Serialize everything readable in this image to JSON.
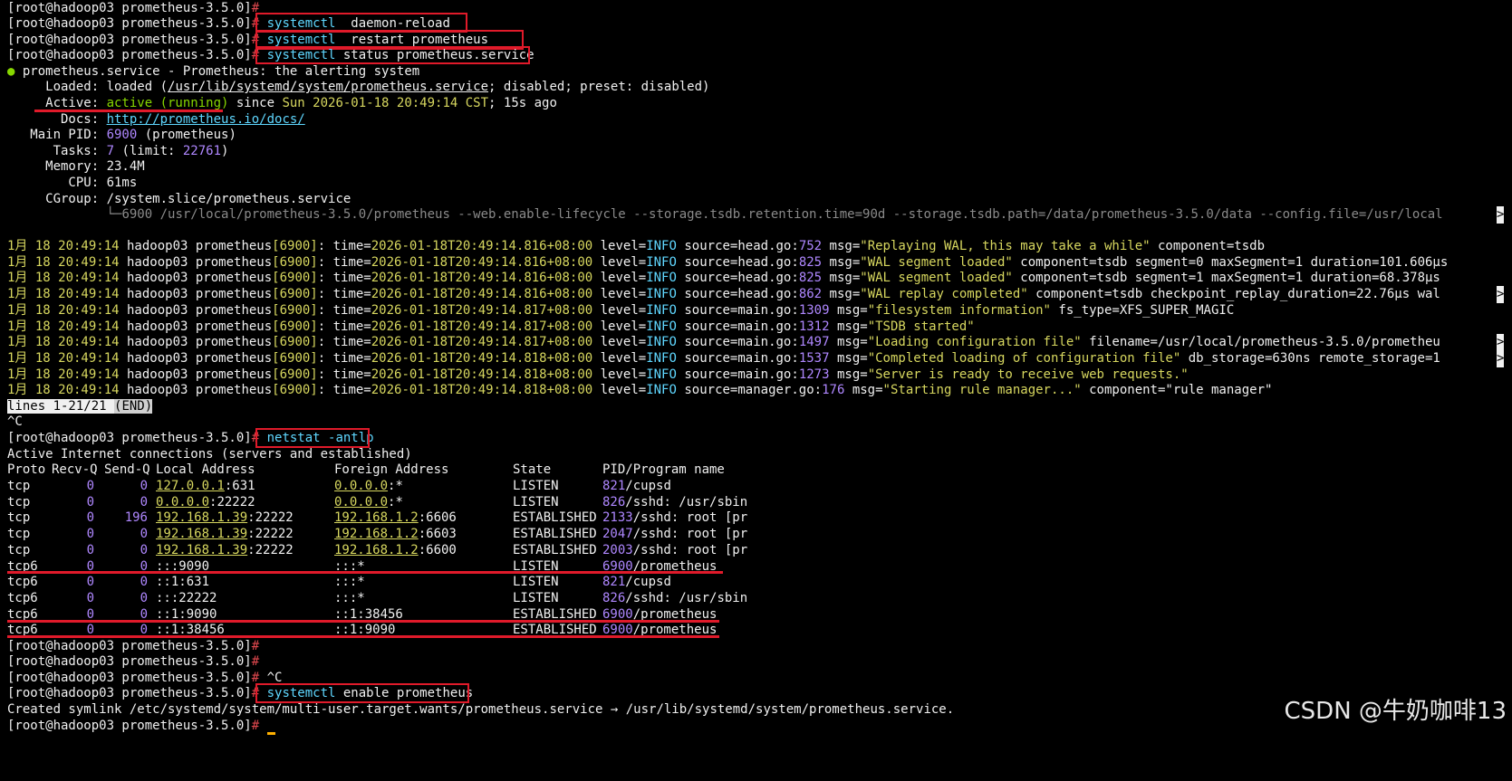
{
  "prompt": "[root@hadoop03 prometheus-3.5.0]",
  "hash": "#",
  "cmds": {
    "c1a": "systemctl",
    "c1b": "  daemon-reload",
    "c2a": "systemctl",
    "c2b": "  restart prometheus",
    "c3a": "systemctl",
    "c3b": " status prometheus.service",
    "c4": "netstat -antlp",
    "c5a": "systemctl",
    "c5b": " enable prometheus"
  },
  "status": {
    "bullet": "●",
    "unit": "prometheus.service",
    "desc": " - Prometheus: the alerting system",
    "loaded_label": "     Loaded: ",
    "loaded_text": "loaded (",
    "loaded_path": "/usr/lib/systemd/system/prometheus.service",
    "loaded_rest": "; disabled; preset: disabled)",
    "active_label": "     Active: ",
    "active_state": "active (running)",
    "active_since": " since ",
    "active_time": "Sun 2026-01-18 20:49:14 CST",
    "active_ago": "; 15s ago",
    "docs_label": "       Docs: ",
    "docs_url": "http://prometheus.io/docs/",
    "pid_label": "   Main PID: ",
    "pid_num": "6900",
    "pid_name": " (prometheus)",
    "tasks_label": "      Tasks: ",
    "tasks_num": "7",
    "tasks_limit_label": " (limit: ",
    "tasks_limit": "22761",
    "tasks_close": ")",
    "memory_label": "     Memory: ",
    "memory_val": "23.4M",
    "cpu_label": "        CPU: ",
    "cpu_val": "61ms",
    "cgroup_label": "     CGroup: ",
    "cgroup_val": "/system.slice/prometheus.service",
    "cgroup_tree": "             └─",
    "cgroup_cmd": "6900 /usr/local/prometheus-3.5.0/prometheus --web.enable-lifecycle --storage.tsdb.retention.time=90d --storage.tsdb.path=/data/prometheus-3.5.0/data --config.file=/usr/local",
    "more_marker": ">"
  },
  "logs": [
    {
      "date": "1月 18 20:49:14",
      "host": " hadoop03 prometheus",
      "pid": "[6900]",
      "time": "2026-01-18T20:49:14.816+08:00",
      "src": "head.go",
      "line": "752",
      "msg": "\"Replaying WAL, this may take a while\"",
      "rest": " component=tsdb",
      "more": false
    },
    {
      "date": "1月 18 20:49:14",
      "host": " hadoop03 prometheus",
      "pid": "[6900]",
      "time": "2026-01-18T20:49:14.816+08:00",
      "src": "head.go",
      "line": "825",
      "msg": "\"WAL segment loaded\"",
      "rest": " component=tsdb segment=0 maxSegment=1 duration=101.606μs",
      "more": false
    },
    {
      "date": "1月 18 20:49:14",
      "host": " hadoop03 prometheus",
      "pid": "[6900]",
      "time": "2026-01-18T20:49:14.816+08:00",
      "src": "head.go",
      "line": "825",
      "msg": "\"WAL segment loaded\"",
      "rest": " component=tsdb segment=1 maxSegment=1 duration=68.378μs",
      "more": false
    },
    {
      "date": "1月 18 20:49:14",
      "host": " hadoop03 prometheus",
      "pid": "[6900]",
      "time": "2026-01-18T20:49:14.816+08:00",
      "src": "head.go",
      "line": "862",
      "msg": "\"WAL replay completed\"",
      "rest": " component=tsdb checkpoint_replay_duration=22.76μs wal",
      "more": true
    },
    {
      "date": "1月 18 20:49:14",
      "host": " hadoop03 prometheus",
      "pid": "[6900]",
      "time": "2026-01-18T20:49:14.817+08:00",
      "src": "main.go",
      "line": "1309",
      "msg": "\"filesystem information\"",
      "rest": " fs_type=XFS_SUPER_MAGIC",
      "more": false
    },
    {
      "date": "1月 18 20:49:14",
      "host": " hadoop03 prometheus",
      "pid": "[6900]",
      "time": "2026-01-18T20:49:14.817+08:00",
      "src": "main.go",
      "line": "1312",
      "msg": "\"TSDB started\"",
      "rest": "",
      "more": false
    },
    {
      "date": "1月 18 20:49:14",
      "host": " hadoop03 prometheus",
      "pid": "[6900]",
      "time": "2026-01-18T20:49:14.817+08:00",
      "src": "main.go",
      "line": "1497",
      "msg": "\"Loading configuration file\"",
      "rest": " filename=/usr/local/prometheus-3.5.0/prometheu",
      "more": true
    },
    {
      "date": "1月 18 20:49:14",
      "host": " hadoop03 prometheus",
      "pid": "[6900]",
      "time": "2026-01-18T20:49:14.818+08:00",
      "src": "main.go",
      "line": "1537",
      "msg": "\"Completed loading of configuration file\"",
      "rest": " db_storage=630ns remote_storage=1",
      "more": true
    },
    {
      "date": "1月 18 20:49:14",
      "host": " hadoop03 prometheus",
      "pid": "[6900]",
      "time": "2026-01-18T20:49:14.818+08:00",
      "src": "main.go",
      "line": "1273",
      "msg": "\"Server is ready to receive web requests.\"",
      "rest": "",
      "more": false
    },
    {
      "date": "1月 18 20:49:14",
      "host": " hadoop03 prometheus",
      "pid": "[6900]",
      "time": "2026-01-18T20:49:14.818+08:00",
      "src": "manager.go",
      "line": "176",
      "msg": "\"Starting rule manager...\"",
      "rest": " component=\"rule manager\"",
      "more": false
    }
  ],
  "log_labels": {
    "time": ": time=",
    "level": " level=",
    "level_val": "INFO",
    "source": " source=",
    "colon": ":",
    "msg": " msg="
  },
  "pager": {
    "lines": "lines 1-21/21 ",
    "end": "(END)"
  },
  "ctrl_c": "^C",
  "netstat": {
    "header1": "Active Internet connections (servers and established)",
    "cols": [
      "Proto",
      "Recv-Q",
      "Send-Q",
      "Local Address",
      "Foreign Address",
      "State",
      "PID/Program name"
    ],
    "rows": [
      {
        "proto": "tcp",
        "recv": "0",
        "send": "0",
        "lip": "127.0.0.1",
        "lport": ":631",
        "fip": "0.0.0.0",
        "fport": ":*",
        "state": "LISTEN",
        "pid": "821",
        "prog": "/cupsd"
      },
      {
        "proto": "tcp",
        "recv": "0",
        "send": "0",
        "lip": "0.0.0.0",
        "lport": ":22222",
        "fip": "0.0.0.0",
        "fport": ":*",
        "state": "LISTEN",
        "pid": "826",
        "prog": "/sshd: /usr/sbin"
      },
      {
        "proto": "tcp",
        "recv": "0",
        "send": "196",
        "lip": "192.168.1.39",
        "lport": ":22222",
        "fip": "192.168.1.2",
        "fport": ":6606",
        "state": "ESTABLISHED",
        "pid": "2133",
        "prog": "/sshd: root [pr"
      },
      {
        "proto": "tcp",
        "recv": "0",
        "send": "0",
        "lip": "192.168.1.39",
        "lport": ":22222",
        "fip": "192.168.1.2",
        "fport": ":6603",
        "state": "ESTABLISHED",
        "pid": "2047",
        "prog": "/sshd: root [pr"
      },
      {
        "proto": "tcp",
        "recv": "0",
        "send": "0",
        "lip": "192.168.1.39",
        "lport": ":22222",
        "fip": "192.168.1.2",
        "fport": ":6600",
        "state": "ESTABLISHED",
        "pid": "2003",
        "prog": "/sshd: root [pr"
      },
      {
        "proto": "tcp6",
        "recv": "0",
        "send": "0",
        "lip": "",
        "lport": ":::9090",
        "fip": "",
        "fport": ":::*",
        "state": "LISTEN",
        "pid": "6900",
        "prog": "/prometheus"
      },
      {
        "proto": "tcp6",
        "recv": "0",
        "send": "0",
        "lip": "",
        "lport": "::1:631",
        "fip": "",
        "fport": ":::*",
        "state": "LISTEN",
        "pid": "821",
        "prog": "/cupsd"
      },
      {
        "proto": "tcp6",
        "recv": "0",
        "send": "0",
        "lip": "",
        "lport": ":::22222",
        "fip": "",
        "fport": ":::*",
        "state": "LISTEN",
        "pid": "826",
        "prog": "/sshd: /usr/sbin"
      },
      {
        "proto": "tcp6",
        "recv": "0",
        "send": "0",
        "lip": "",
        "lport": "::1:9090",
        "fip": "",
        "fport": "::1:38456",
        "state": "ESTABLISHED",
        "pid": "6900",
        "prog": "/prometheus"
      },
      {
        "proto": "tcp6",
        "recv": "0",
        "send": "0",
        "lip": "",
        "lport": "::1:38456",
        "fip": "",
        "fport": "::1:9090",
        "state": "ESTABLISHED",
        "pid": "6900",
        "prog": "/prometheus"
      }
    ]
  },
  "symlink": "Created symlink /etc/systemd/system/multi-user.target.wants/prometheus.service → /usr/lib/systemd/system/prometheus.service.",
  "watermark": "CSDN @牛奶咖啡13",
  "colors": {
    "accent": "#e01a2a",
    "cyan": "#5fd7ff",
    "yellow": "#d7d75f",
    "green": "#87d700",
    "purple": "#af87ff"
  }
}
